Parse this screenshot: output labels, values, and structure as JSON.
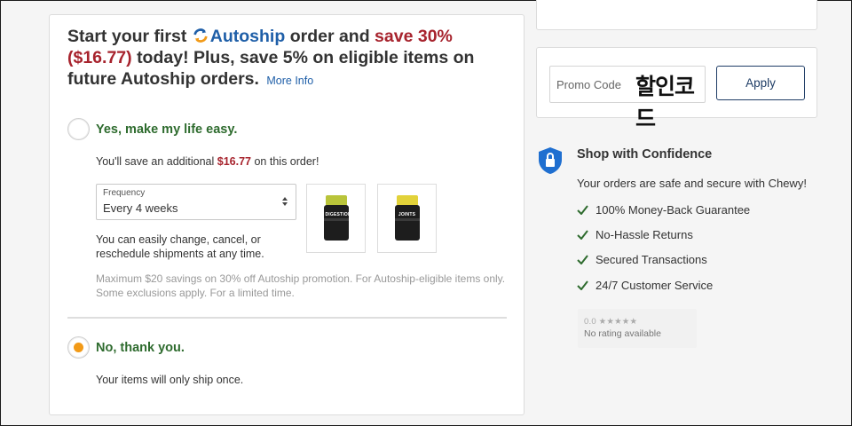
{
  "autoship": {
    "headline_part1": "Start your first",
    "brand": "Autoship",
    "headline_part2": "order and",
    "save_phrase": "save 30% ($16.77)",
    "headline_part3": "today! Plus, save 5% on eligible items on future Autoship orders.",
    "more_info": "More Info",
    "option_yes_label": "Yes, make my life easy.",
    "savings_prefix": "You'll save an additional",
    "savings_amount": "$16.77",
    "savings_suffix": "on this order!",
    "frequency_label": "Frequency",
    "frequency_value": "Every 4 weeks",
    "change_note_line1": "You can easily change, cancel, or",
    "change_note_line2": "reschedule shipments at any time.",
    "fine_print": "Maximum $20 savings on 30% off Autoship promotion. For Autoship-eligible items only. Some exclusions apply. For a limited time.",
    "option_no_label": "No, thank you.",
    "ship_once_text": "Your items will only ship once.",
    "selected_option": "no",
    "products": [
      {
        "name": "DIGESTION",
        "lid_color": "#b9c43a"
      },
      {
        "name": "JOINTS",
        "lid_color": "#e2d23a"
      }
    ]
  },
  "promo": {
    "placeholder": "Promo Code",
    "overlay_text": "할인코드",
    "apply_label": "Apply"
  },
  "confidence": {
    "title": "Shop with Confidence",
    "subtitle": "Your orders are safe and secure with Chewy!",
    "guarantees": [
      "100% Money-Back Guarantee",
      "No-Hassle Returns",
      "Secured Transactions",
      "24/7 Customer Service"
    ],
    "rating_score": "0.0",
    "rating_stars": "★★★★★",
    "rating_text": "No rating available"
  },
  "colors": {
    "brand_blue": "#1f5fa8",
    "save_red": "#a7232d",
    "option_green": "#2e6b2e",
    "radio_orange": "#f29a17",
    "shield_blue": "#1f6fd0",
    "check_green": "#2e6b2e"
  }
}
